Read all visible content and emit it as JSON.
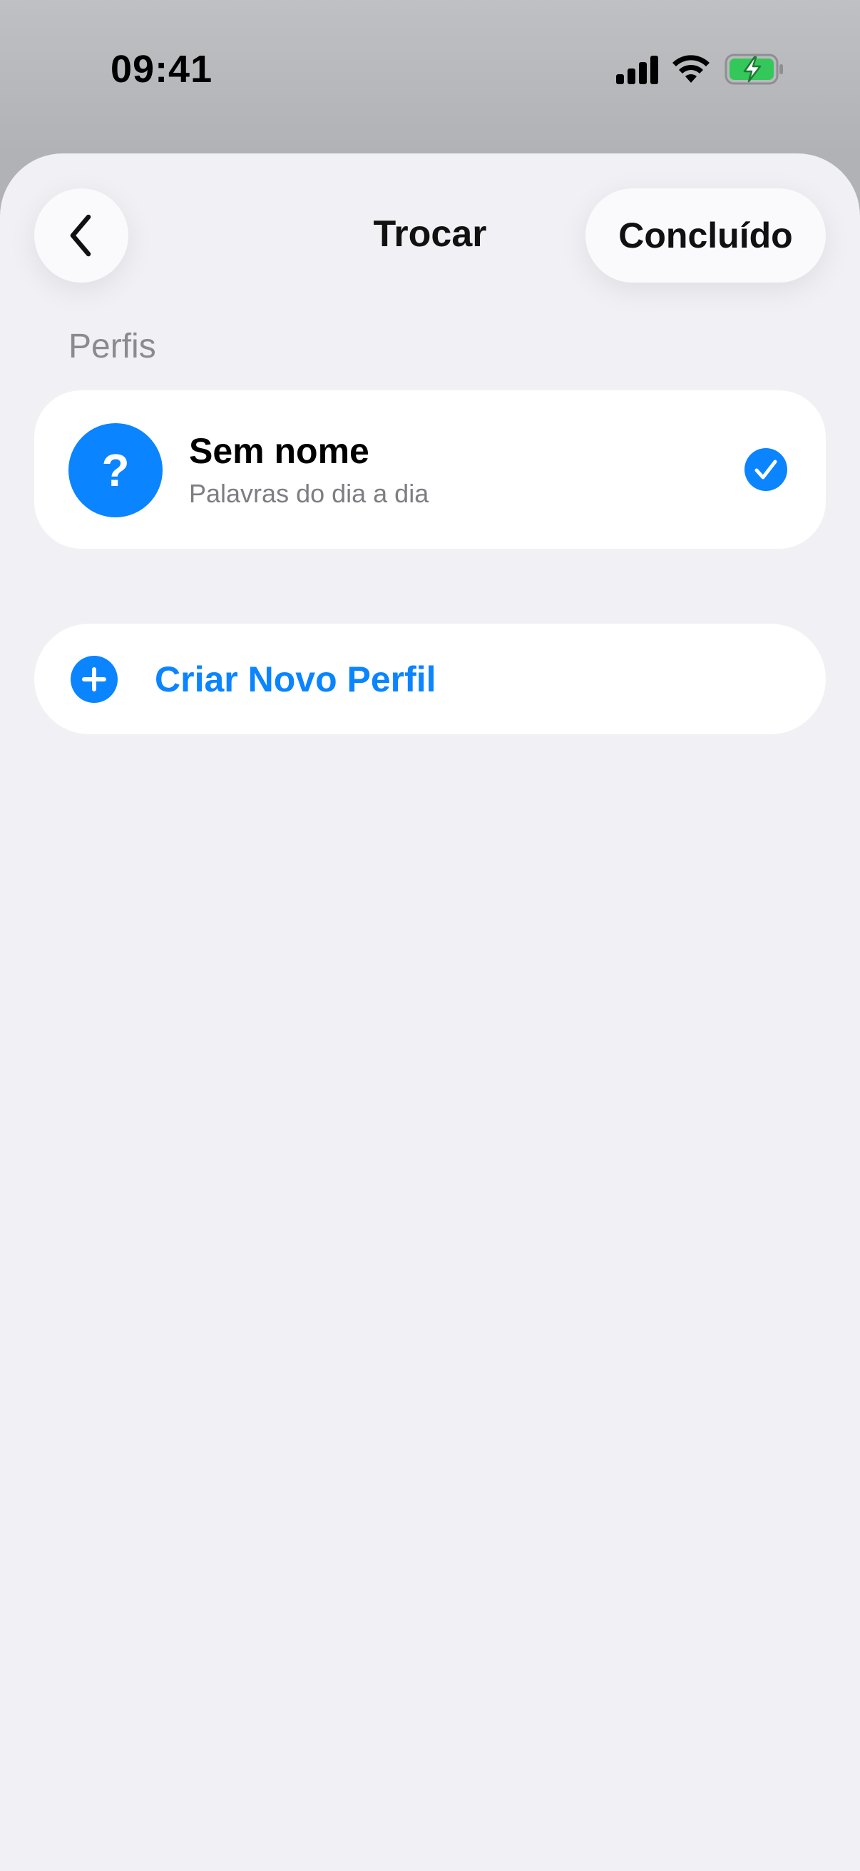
{
  "status_bar": {
    "time": "09:41",
    "icons": [
      "signal-icon",
      "wifi-icon",
      "battery-charging-icon"
    ]
  },
  "nav": {
    "back_icon": "chevron-left-icon",
    "title": "Trocar",
    "done_label": "Concluído"
  },
  "profiles": {
    "section_title": "Perfis",
    "items": [
      {
        "avatar_symbol": "?",
        "name": "Sem nome",
        "subtitle": "Palavras do dia a dia",
        "selected": true
      }
    ]
  },
  "create_profile": {
    "icon": "plus-circle-icon",
    "label": "Criar Novo Perfil"
  },
  "colors": {
    "accent": "#0a84ff",
    "sheet_background": "#f1f1f5",
    "battery_green": "#34c759"
  }
}
